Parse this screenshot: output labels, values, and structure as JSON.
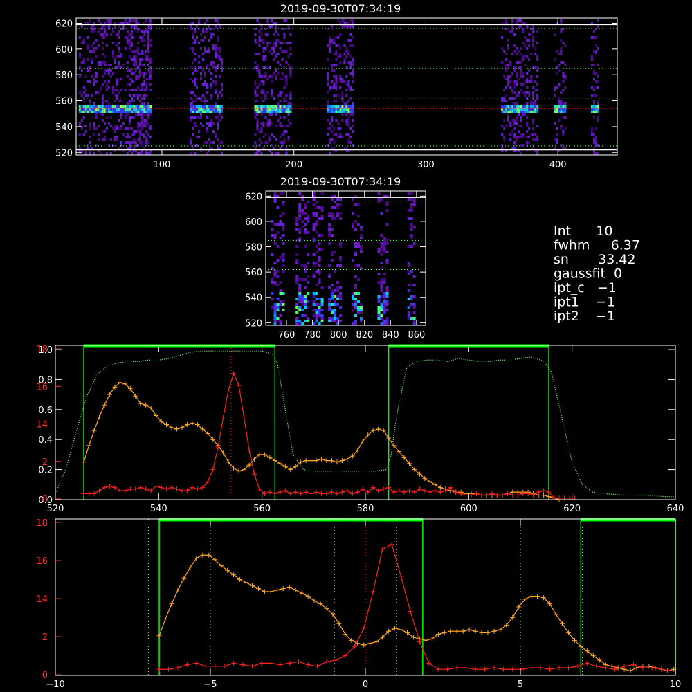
{
  "colors": {
    "background": "#000000",
    "axis": "#ffffff",
    "red_series": "#ff2020",
    "orange_series": "#ffa726",
    "green_band": "#00ff00",
    "green_dotted": "#7dff7d",
    "red_axis": "#ff3030"
  },
  "panels": {
    "top": {
      "title": "2019-09-30T07:34:19"
    },
    "middle": {
      "title": "2019-09-30T07:34:19"
    }
  },
  "info": {
    "lines": [
      "Int      10",
      "fwhm     6.37",
      "sn       33.42",
      "gaussfit  0",
      "ipt_c   −1",
      "ipt1    −1",
      "ipt2    −1"
    ]
  },
  "chart_data": [
    {
      "type": "heatmap",
      "title": "2019-09-30T07:34:19",
      "x_ticks": [
        "100",
        "200",
        "300",
        "400"
      ],
      "y_ticks": [
        "520",
        "540",
        "560",
        "580",
        "600",
        "620"
      ],
      "xlim": [
        35,
        445
      ],
      "ylim": [
        518,
        624
      ],
      "hlines": [
        {
          "y": 616,
          "color": "green-dotted"
        },
        {
          "y": 585,
          "color": "green-dotted"
        },
        {
          "y": 562,
          "color": "green-dotted"
        },
        {
          "y": 554,
          "color": "red-dotted"
        },
        {
          "y": 525,
          "color": "green-dotted"
        }
      ],
      "white_hlines": [
        619,
        522
      ],
      "bright_row": 554,
      "column_bands": [
        [
          37,
          91
        ],
        [
          75,
          91
        ],
        [
          121,
          146
        ],
        [
          170,
          197
        ],
        [
          225,
          245
        ],
        [
          357,
          385
        ],
        [
          397,
          406
        ],
        [
          425,
          430
        ]
      ]
    },
    {
      "type": "heatmap",
      "title": "2019-09-30T07:34:19",
      "x_ticks": [
        "760",
        "780",
        "800",
        "820",
        "840",
        "860"
      ],
      "y_ticks": [
        "520",
        "540",
        "560",
        "580",
        "600",
        "620"
      ],
      "xlim": [
        744,
        867
      ],
      "ylim": [
        518,
        624
      ],
      "hlines": [
        {
          "y": 616,
          "color": "green-dotted"
        },
        {
          "y": 585,
          "color": "green-dotted"
        },
        {
          "y": 562,
          "color": "green-dotted"
        }
      ],
      "white_hlines": [
        619
      ],
      "column_bands": [
        [
          748,
          757
        ],
        [
          767,
          776
        ],
        [
          780,
          788
        ],
        [
          792,
          802
        ],
        [
          810,
          818
        ],
        [
          830,
          838
        ],
        [
          853,
          858
        ]
      ]
    },
    {
      "type": "line",
      "x_ticks": [
        "520",
        "540",
        "560",
        "580",
        "600",
        "620",
        "640"
      ],
      "xlim": [
        520,
        640
      ],
      "y_ticks_left_white": [
        "0.0",
        "0.2",
        "0.4",
        "0.6",
        "0.8",
        "1.0"
      ],
      "y_ticks_left_red": [
        "0",
        "2",
        "14",
        "16",
        "18"
      ],
      "ylim": [
        0,
        1.0
      ],
      "green_bands": [
        [
          525.5,
          562.5
        ],
        [
          584.5,
          615.5
        ]
      ],
      "vline_red": 554,
      "series": [
        {
          "color": "orange",
          "x": [
            525.5,
            526.5,
            527.5,
            528.5,
            529.5,
            530.5,
            531.5,
            532.5,
            533.5,
            534.5,
            535.5,
            536.5,
            537.5,
            538.5,
            539.5,
            540.5,
            541.5,
            542.5,
            543.5,
            544.5,
            545.5,
            546.5,
            547.5,
            548.5,
            549.5,
            550.5,
            551.5,
            552.5,
            553.5,
            554.5,
            555.5,
            556.5,
            557.5,
            558.5,
            559.5,
            560.5,
            561.5,
            562.5,
            563.5,
            564.5,
            565.5,
            566.5,
            567.5,
            568.5,
            569.5,
            570.5,
            571.5,
            572.5,
            573.5,
            574.5,
            575.5,
            576.5,
            577.5,
            578.5,
            579.5,
            580.5,
            581.5,
            582.5,
            583.5,
            584.5,
            585.5,
            586.5,
            587.5,
            588.5,
            589.5,
            590.5,
            591.5,
            592.5,
            593.5,
            594.5,
            595.5,
            596.5,
            597.5,
            598.5,
            599.5,
            600.5,
            601.5,
            602.5,
            603.5,
            604.5,
            605.5,
            606.5,
            607.5,
            608.5,
            609.5,
            610.5,
            611.5,
            612.5,
            613.5,
            614.5,
            615.5,
            616.5,
            617.5
          ],
          "values": [
            0.25,
            0.36,
            0.46,
            0.55,
            0.63,
            0.7,
            0.75,
            0.78,
            0.77,
            0.74,
            0.69,
            0.64,
            0.63,
            0.61,
            0.56,
            0.52,
            0.5,
            0.48,
            0.47,
            0.48,
            0.5,
            0.51,
            0.5,
            0.47,
            0.44,
            0.4,
            0.36,
            0.31,
            0.25,
            0.21,
            0.19,
            0.2,
            0.23,
            0.27,
            0.3,
            0.3,
            0.28,
            0.26,
            0.24,
            0.22,
            0.2,
            0.22,
            0.25,
            0.26,
            0.26,
            0.26,
            0.27,
            0.26,
            0.26,
            0.25,
            0.26,
            0.27,
            0.29,
            0.33,
            0.39,
            0.43,
            0.46,
            0.47,
            0.46,
            0.41,
            0.36,
            0.32,
            0.28,
            0.24,
            0.2,
            0.17,
            0.14,
            0.12,
            0.1,
            0.08,
            0.07,
            0.06,
            0.05,
            0.05,
            0.04,
            0.04,
            0.04,
            0.03,
            0.03,
            0.03,
            0.03,
            0.03,
            0.04,
            0.05,
            0.05,
            0.05,
            0.05,
            0.04,
            0.03,
            0.03,
            0.02,
            0.01,
            0.0
          ]
        },
        {
          "color": "red",
          "x": [
            525.5,
            526.5,
            527.5,
            528.5,
            529.5,
            530.5,
            531.5,
            532.5,
            533.5,
            534.5,
            535.5,
            536.5,
            537.5,
            538.5,
            539.5,
            540.5,
            541.5,
            542.5,
            543.5,
            544.5,
            545.5,
            546.5,
            547.5,
            548.5,
            549.5,
            550.5,
            551.5,
            552.5,
            553.5,
            554.5,
            555.5,
            556.5,
            557.5,
            558.5,
            559.5,
            560.5,
            561.5,
            562.5,
            563.5,
            564.5,
            565.5,
            566.5,
            567.5,
            568.5,
            569.5,
            570.5,
            571.5,
            572.5,
            573.5,
            574.5,
            575.5,
            576.5,
            577.5,
            578.5,
            579.5,
            580.5,
            581.5,
            582.5,
            583.5,
            584.5,
            585.5,
            586.5,
            587.5,
            588.5,
            589.5,
            590.5,
            591.5,
            592.5,
            593.5,
            594.5,
            595.5,
            596.5,
            597.5,
            598.5,
            599.5,
            600.5,
            601.5,
            602.5,
            603.5,
            604.5,
            605.5,
            606.5,
            607.5,
            608.5,
            609.5,
            610.5,
            611.5,
            612.5,
            613.5,
            614.5,
            615.5,
            616.5,
            617.5,
            618.5,
            619.5,
            620.5
          ],
          "values": [
            0.04,
            0.04,
            0.04,
            0.06,
            0.08,
            0.09,
            0.08,
            0.06,
            0.06,
            0.07,
            0.07,
            0.08,
            0.07,
            0.06,
            0.09,
            0.08,
            0.07,
            0.08,
            0.07,
            0.06,
            0.06,
            0.08,
            0.07,
            0.08,
            0.12,
            0.2,
            0.35,
            0.55,
            0.73,
            0.84,
            0.76,
            0.55,
            0.33,
            0.17,
            0.07,
            0.04,
            0.05,
            0.04,
            0.05,
            0.06,
            0.04,
            0.05,
            0.04,
            0.05,
            0.04,
            0.05,
            0.04,
            0.04,
            0.05,
            0.04,
            0.05,
            0.06,
            0.04,
            0.05,
            0.07,
            0.05,
            0.08,
            0.06,
            0.07,
            0.08,
            0.05,
            0.06,
            0.05,
            0.06,
            0.05,
            0.07,
            0.06,
            0.05,
            0.06,
            0.05,
            0.06,
            0.08,
            0.05,
            0.04,
            0.03,
            0.03,
            0.04,
            0.03,
            0.03,
            0.04,
            0.03,
            0.03,
            0.04,
            0.03,
            0.03,
            0.04,
            0.04,
            0.03,
            0.05,
            0.06,
            0.05,
            0.01,
            0.01,
            0.01,
            0.01,
            0.01
          ]
        },
        {
          "color": "green-dotted",
          "x": [
            520,
            522,
            524,
            526,
            528,
            530,
            532,
            534,
            536,
            538,
            540,
            542,
            544,
            546,
            548,
            550,
            552,
            554,
            556,
            558,
            560,
            562,
            563,
            564,
            566,
            568,
            570,
            572,
            574,
            576,
            578,
            580,
            582,
            584,
            585,
            586,
            588,
            590,
            592,
            594,
            596,
            598,
            600,
            602,
            604,
            606,
            608,
            610,
            612,
            614,
            615,
            616,
            618,
            620,
            622,
            624,
            626,
            630,
            634,
            638,
            640
          ],
          "values": [
            0.04,
            0.2,
            0.45,
            0.68,
            0.83,
            0.89,
            0.91,
            0.92,
            0.92,
            0.93,
            0.93,
            0.94,
            0.96,
            0.98,
            0.99,
            0.99,
            0.99,
            0.99,
            0.99,
            0.99,
            0.99,
            0.97,
            0.9,
            0.7,
            0.3,
            0.2,
            0.19,
            0.19,
            0.19,
            0.19,
            0.19,
            0.19,
            0.19,
            0.2,
            0.3,
            0.55,
            0.88,
            0.92,
            0.93,
            0.93,
            0.92,
            0.94,
            0.93,
            0.92,
            0.92,
            0.93,
            0.93,
            0.94,
            0.95,
            0.93,
            0.9,
            0.85,
            0.55,
            0.25,
            0.1,
            0.05,
            0.04,
            0.03,
            0.03,
            0.02,
            0.02
          ]
        }
      ]
    },
    {
      "type": "line",
      "x_ticks": [
        "−10",
        "−5",
        "0",
        "5",
        "10"
      ],
      "xlim": [
        -10,
        10
      ],
      "y_ticks_left_red": [
        "0",
        "2",
        "14",
        "16",
        "18"
      ],
      "ylim": [
        0,
        1.0
      ],
      "green_bands": [
        [
          -6.65,
          1.85
        ],
        [
          6.95,
          10
        ]
      ],
      "vlines_white": [
        -7.0,
        -5.0,
        -1.0,
        1.0,
        5.0,
        7.0
      ],
      "vline_red": 0,
      "series": [
        {
          "color": "orange",
          "x": [
            -6.65,
            -6.45,
            -6.25,
            -6.05,
            -5.85,
            -5.65,
            -5.45,
            -5.25,
            -5.05,
            -4.85,
            -4.65,
            -4.45,
            -4.25,
            -4.05,
            -3.85,
            -3.65,
            -3.45,
            -3.25,
            -3.05,
            -2.85,
            -2.65,
            -2.45,
            -2.25,
            -2.05,
            -1.85,
            -1.65,
            -1.45,
            -1.25,
            -1.05,
            -0.85,
            -0.65,
            -0.45,
            -0.25,
            -0.05,
            0.15,
            0.35,
            0.55,
            0.75,
            0.95,
            1.15,
            1.35,
            1.55,
            1.75,
            1.95,
            2.15,
            2.35,
            2.55,
            2.75,
            2.95,
            3.15,
            3.35,
            3.55,
            3.75,
            3.95,
            4.15,
            4.35,
            4.55,
            4.75,
            4.95,
            5.15,
            5.35,
            5.55,
            5.75,
            5.95,
            6.15,
            6.35,
            6.55,
            6.75,
            6.95,
            7.15,
            7.35,
            7.55,
            7.75,
            7.95,
            8.15,
            8.35,
            8.55,
            8.75,
            8.95,
            9.15,
            9.35,
            9.55,
            9.75,
            9.95
          ],
          "values": [
            0.26,
            0.37,
            0.47,
            0.56,
            0.64,
            0.71,
            0.77,
            0.79,
            0.79,
            0.76,
            0.72,
            0.69,
            0.66,
            0.63,
            0.61,
            0.59,
            0.57,
            0.55,
            0.55,
            0.56,
            0.57,
            0.58,
            0.56,
            0.54,
            0.52,
            0.49,
            0.47,
            0.44,
            0.4,
            0.34,
            0.27,
            0.23,
            0.21,
            0.2,
            0.21,
            0.22,
            0.25,
            0.29,
            0.31,
            0.3,
            0.28,
            0.25,
            0.24,
            0.23,
            0.24,
            0.27,
            0.28,
            0.29,
            0.29,
            0.29,
            0.3,
            0.29,
            0.28,
            0.28,
            0.29,
            0.3,
            0.33,
            0.38,
            0.45,
            0.5,
            0.52,
            0.52,
            0.51,
            0.47,
            0.4,
            0.34,
            0.28,
            0.23,
            0.19,
            0.16,
            0.13,
            0.1,
            0.07,
            0.06,
            0.05,
            0.04,
            0.03,
            0.05,
            0.06,
            0.06,
            0.05,
            0.04,
            0.03,
            0.04
          ]
        },
        {
          "color": "red",
          "x": [
            -6.65,
            -6.35,
            -6.05,
            -5.75,
            -5.45,
            -5.15,
            -4.85,
            -4.55,
            -4.25,
            -3.95,
            -3.65,
            -3.35,
            -3.05,
            -2.75,
            -2.45,
            -2.15,
            -1.85,
            -1.55,
            -1.25,
            -0.95,
            -0.65,
            -0.35,
            -0.05,
            0.25,
            0.55,
            0.85,
            1.15,
            1.45,
            1.75,
            2.05,
            2.35,
            2.65,
            2.95,
            3.25,
            3.55,
            3.85,
            4.15,
            4.45,
            4.75,
            5.05,
            5.35,
            5.65,
            5.95,
            6.25,
            6.55,
            6.85,
            7.15,
            7.45,
            7.75,
            8.05,
            8.35,
            8.65,
            8.95,
            9.25,
            9.55,
            9.85
          ],
          "values": [
            0.04,
            0.04,
            0.05,
            0.07,
            0.08,
            0.06,
            0.06,
            0.06,
            0.08,
            0.07,
            0.06,
            0.08,
            0.08,
            0.07,
            0.08,
            0.09,
            0.07,
            0.06,
            0.09,
            0.1,
            0.13,
            0.19,
            0.31,
            0.55,
            0.83,
            0.86,
            0.65,
            0.42,
            0.22,
            0.08,
            0.04,
            0.04,
            0.05,
            0.05,
            0.04,
            0.04,
            0.05,
            0.04,
            0.04,
            0.04,
            0.05,
            0.05,
            0.04,
            0.05,
            0.05,
            0.06,
            0.08,
            0.06,
            0.05,
            0.04,
            0.06,
            0.07,
            0.05,
            0.05,
            0.04,
            0.03
          ]
        }
      ]
    }
  ]
}
